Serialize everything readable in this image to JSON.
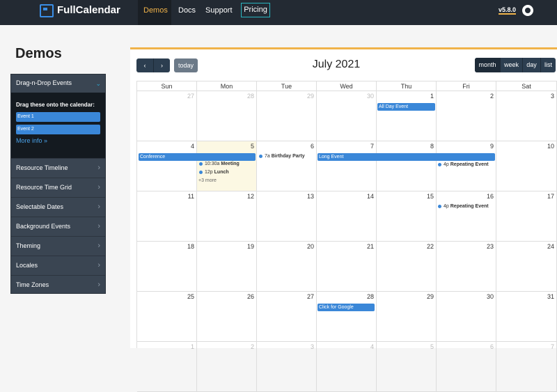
{
  "topbar": {
    "brand": "FullCalendar",
    "nav": [
      "Demos",
      "Docs",
      "Support"
    ],
    "pricing": "Pricing",
    "version": "v5.8.0"
  },
  "sidebar": {
    "title": "Demos",
    "dnd": {
      "heading": "Drag-n-Drop Events",
      "instruction": "Drag these onto the calendar:",
      "events": [
        "Event 1",
        "Event 2"
      ],
      "more_info": "More info »"
    },
    "items": [
      "Resource Timeline",
      "Resource Time Grid",
      "Selectable Dates",
      "Background Events",
      "Theming",
      "Locales",
      "Time Zones"
    ]
  },
  "calendar": {
    "title": "July 2021",
    "today_label": "today",
    "prev_icon": "‹",
    "next_icon": "›",
    "views": [
      "month",
      "week",
      "day",
      "list"
    ],
    "weekdays": [
      "Sun",
      "Mon",
      "Tue",
      "Wed",
      "Thu",
      "Fri",
      "Sat"
    ],
    "weeks": [
      [
        "27",
        "28",
        "29",
        "30",
        "1",
        "2",
        "3"
      ],
      [
        "4",
        "5",
        "6",
        "7",
        "8",
        "9",
        "10"
      ],
      [
        "11",
        "12",
        "13",
        "14",
        "15",
        "16",
        "17"
      ],
      [
        "18",
        "19",
        "20",
        "21",
        "22",
        "23",
        "24"
      ],
      [
        "25",
        "26",
        "27",
        "28",
        "29",
        "30",
        "31"
      ],
      [
        "1",
        "2",
        "3",
        "4",
        "5",
        "6",
        "7"
      ]
    ],
    "events": {
      "all_day": "All Day Event",
      "conference": "Conference",
      "long_event": "Long Event",
      "meeting": {
        "time": "10:30a",
        "title": "Meeting"
      },
      "lunch": {
        "time": "12p",
        "title": "Lunch"
      },
      "more": "+3 more",
      "birthday": {
        "time": "7a",
        "title": "Birthday Party"
      },
      "repeating1": {
        "time": "4p",
        "title": "Repeating Event"
      },
      "repeating2": {
        "time": "4p",
        "title": "Repeating Event"
      },
      "google": "Click for Google"
    }
  },
  "colors": {
    "topbar": "#232a33",
    "accent": "#f0b34a",
    "event": "#3a87d8",
    "today": "#fcf8e3"
  }
}
